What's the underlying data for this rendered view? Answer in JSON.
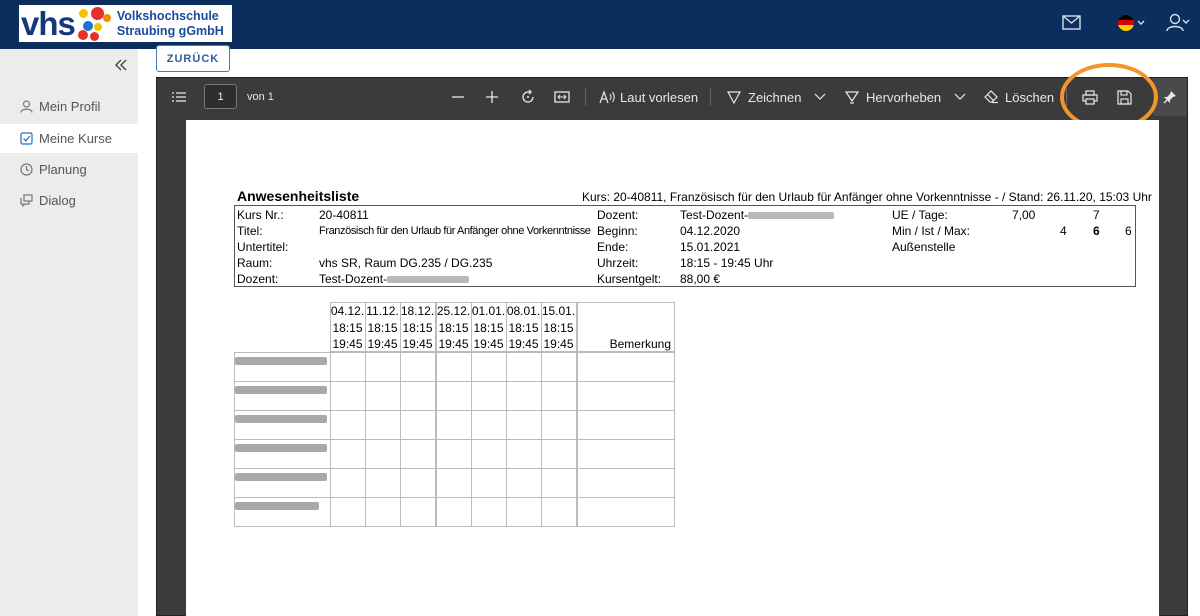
{
  "header": {
    "logo_mark": "vhs",
    "logo_line1": "Volkshochschule",
    "logo_line2": "Straubing gGmbH",
    "icons": [
      "mail-icon",
      "flag-de-icon",
      "user-settings-icon"
    ]
  },
  "sidebar": {
    "collapse_icon": "double-chevron-left-icon",
    "items": [
      {
        "label": "Mein Profil",
        "icon": "user-icon",
        "active": false
      },
      {
        "label": "Meine Kurse",
        "icon": "check-square-icon",
        "active": true
      },
      {
        "label": "Planung",
        "icon": "clock-icon",
        "active": false
      },
      {
        "label": "Dialog",
        "icon": "chat-icon",
        "active": false
      }
    ]
  },
  "back_button": "ZURÜCK",
  "viewer": {
    "page_value": "1",
    "page_of": "von 1",
    "read_aloud": "Laut vorlesen",
    "draw": "Zeichnen",
    "highlight": "Hervorheben",
    "erase": "Löschen",
    "accent_ring_color": "#f2962a"
  },
  "document": {
    "title": "Anwesenheitsliste",
    "kurs_line": "Kurs: 20-40811, Französisch für den Urlaub für Anfänger ohne Vorkenntnisse - / Stand: 26.11.20, 15:03 Uhr",
    "info": {
      "kurs_nr_label": "Kurs Nr.:",
      "kurs_nr": "20-40811",
      "titel_label": "Titel:",
      "titel": "Französisch für den Urlaub für Anfänger ohne Vorkenntnisse",
      "untertitel_label": "Untertitel:",
      "raum_label": "Raum:",
      "raum": "vhs SR, Raum DG.235 / DG.235",
      "dozent_label": "Dozent:",
      "dozent": "Test-Dozent-",
      "dozent2_label": "Dozent:",
      "dozent2": "Test-Dozent-",
      "beginn_label": "Beginn:",
      "beginn": "04.12.2020",
      "ende_label": "Ende:",
      "ende": "15.01.2021",
      "uhrzeit_label": "Uhrzeit:",
      "uhrzeit": "18:15 - 19:45 Uhr",
      "kursentgelt_label": "Kursentgelt:",
      "kursentgelt": "88,00 €",
      "ue_label": "UE / Tage:",
      "ue": "7,00",
      "tage": "7",
      "minmax_label": "Min / Ist / Max:",
      "min": "4",
      "ist": "6",
      "max": "6",
      "aussenstelle_label": "Außenstelle"
    },
    "dates": [
      {
        "date": "04.12.",
        "start": "18:15",
        "end": "19:45"
      },
      {
        "date": "11.12.",
        "start": "18:15",
        "end": "19:45"
      },
      {
        "date": "18.12.",
        "start": "18:15",
        "end": "19:45"
      },
      {
        "date": "25.12.",
        "start": "18:15",
        "end": "19:45"
      },
      {
        "date": "01.01.",
        "start": "18:15",
        "end": "19:45"
      },
      {
        "date": "08.01.",
        "start": "18:15",
        "end": "19:45"
      },
      {
        "date": "15.01.",
        "start": "18:15",
        "end": "19:45"
      }
    ],
    "remark_header": "Bemerkung",
    "participant_rows": 6
  }
}
